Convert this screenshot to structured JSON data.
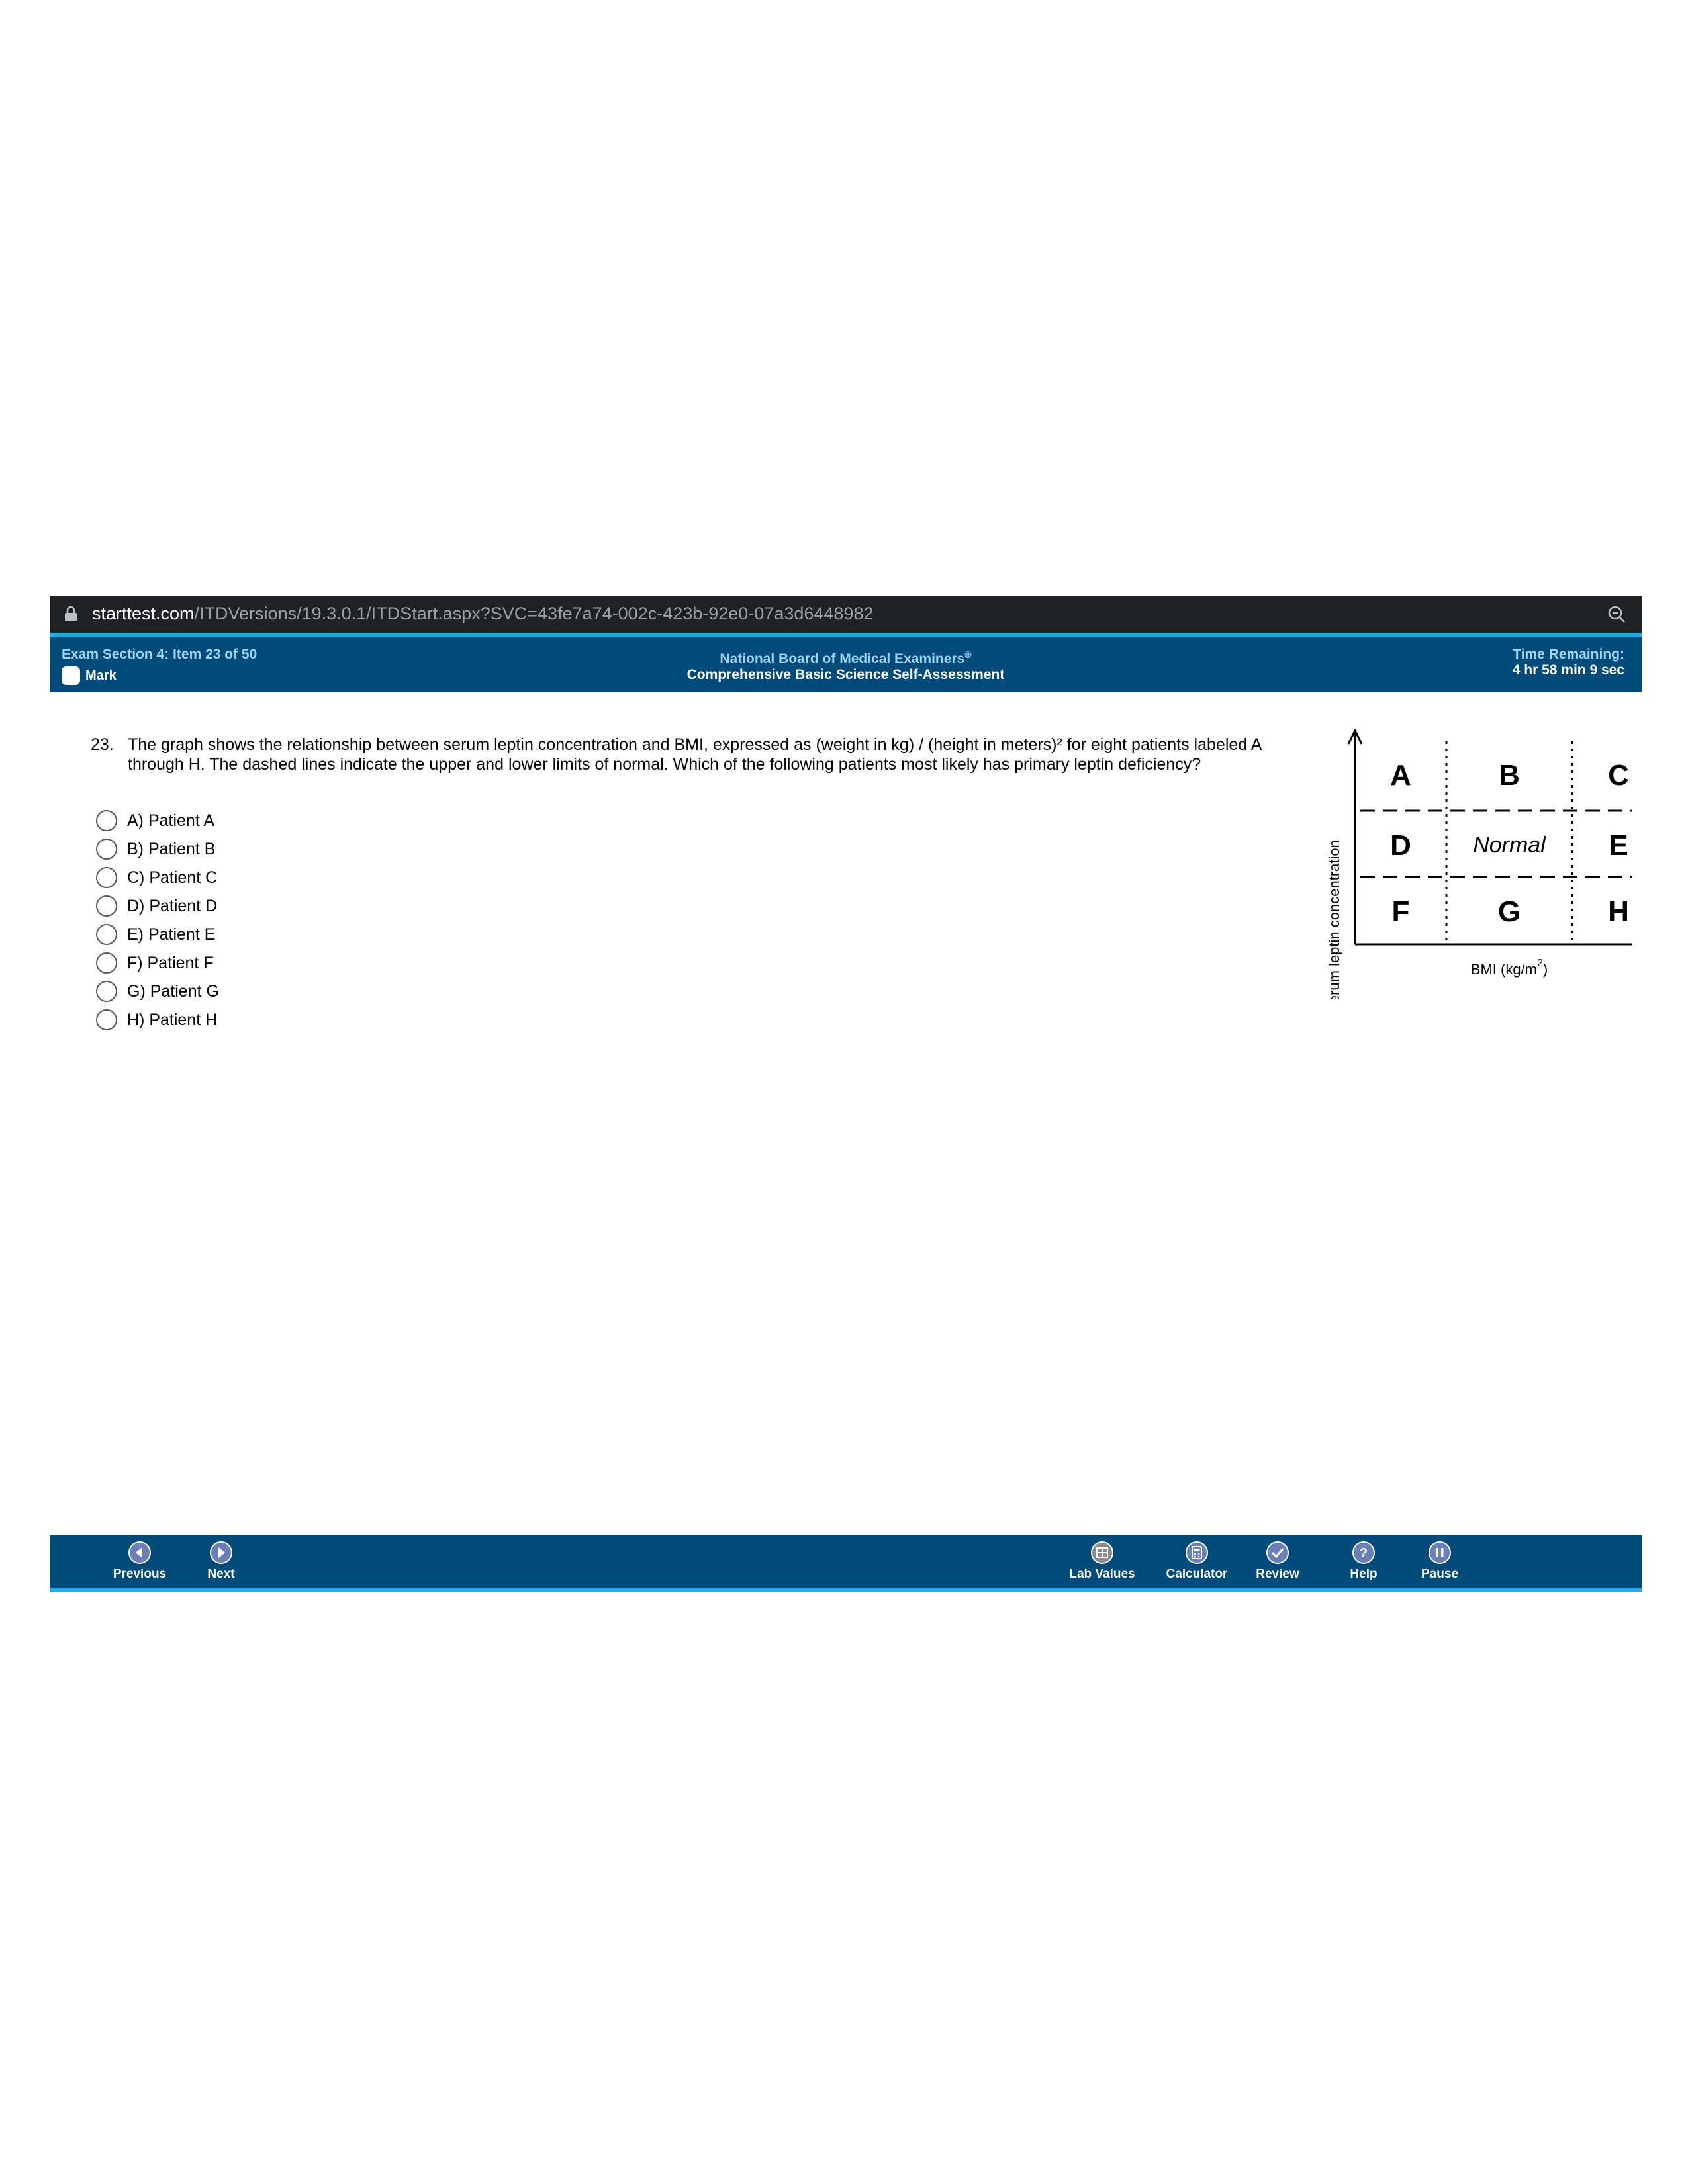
{
  "browser": {
    "url_host": "starttest.com",
    "url_path": "/ITDVersions/19.3.0.1/ITDStart.aspx?SVC=43fe7a74-002c-423b-92e0-07a3d6448982"
  },
  "header": {
    "section": "Exam Section 4: Item 23 of 50",
    "mark_label": "Mark",
    "organization": "National Board of Medical Examiners",
    "registered": "®",
    "exam_title": "Comprehensive Basic Science Self-Assessment",
    "time_label": "Time Remaining:",
    "time_value": "4 hr 58 min 9 sec"
  },
  "question": {
    "number": "23.",
    "stem": "The graph shows the relationship between serum leptin concentration and BMI, expressed as (weight in kg) / (height in meters)² for eight patients labeled A through H. The dashed lines indicate the upper and lower limits of normal. Which of the following patients most likely has primary leptin deficiency?",
    "options": [
      {
        "label": "A) Patient A"
      },
      {
        "label": "B) Patient B"
      },
      {
        "label": "C) Patient C"
      },
      {
        "label": "D) Patient D"
      },
      {
        "label": "E) Patient E"
      },
      {
        "label": "F) Patient F"
      },
      {
        "label": "G) Patient G"
      },
      {
        "label": "H) Patient H"
      }
    ]
  },
  "graph": {
    "ylabel": "Serum leptin concentration",
    "xlabel": "BMI (kg/m",
    "xlabel_sup": "2",
    "xlabel_end": ")",
    "cells": [
      "A",
      "B",
      "C",
      "D",
      "Normal",
      "E",
      "F",
      "G",
      "H"
    ]
  },
  "toolbar": {
    "previous": "Previous",
    "next": "Next",
    "lab_values": "Lab Values",
    "calculator": "Calculator",
    "review": "Review",
    "help": "Help",
    "pause": "Pause"
  },
  "colors": {
    "header_bg": "#004b7a",
    "accent": "#27a8e0",
    "label_blue": "#9fd4f7"
  }
}
